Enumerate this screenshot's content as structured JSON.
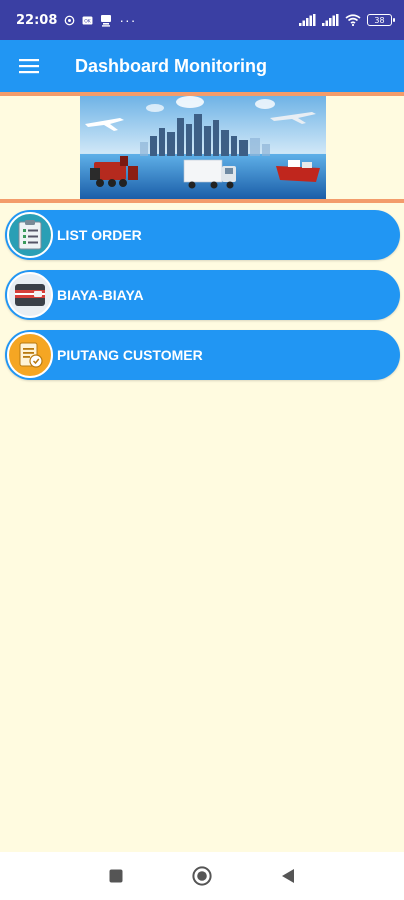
{
  "status_bar": {
    "time": "22:08",
    "notif_extra": "···",
    "battery_level": "38",
    "icons": [
      "whatsapp-icon",
      "sim-card-icon",
      "download-icon",
      "signal-icon",
      "wifi-icon",
      "battery-icon"
    ]
  },
  "app_bar": {
    "title": "Dashboard Monitoring",
    "menu_icon": "hamburger-menu-icon",
    "color": "#2196f3"
  },
  "banner": {
    "image": "logistics-city-banner"
  },
  "menu": {
    "items": [
      {
        "label": "LIST ORDER",
        "icon": "clipboard-list-icon"
      },
      {
        "label": "BIAYA-BIAYA",
        "icon": "wallet-icon"
      },
      {
        "label": "PIUTANG CUSTOMER",
        "icon": "invoice-icon"
      }
    ]
  },
  "nav_bar": {
    "buttons": [
      "recents-square-icon",
      "home-circle-icon",
      "back-triangle-icon"
    ]
  },
  "colors": {
    "background": "#fffbe0",
    "status_bar": "#3a3fa3",
    "accent": "#f39c6b",
    "button": "#2196f3"
  }
}
